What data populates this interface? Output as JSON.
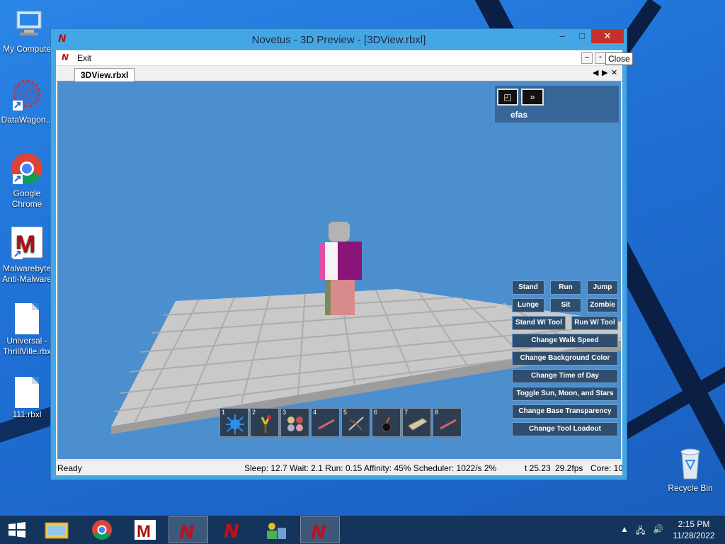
{
  "desktop": {
    "icons": [
      {
        "label": "My Compute",
        "icon": "computer-icon"
      },
      {
        "label": "DataWagon...",
        "icon": "datawagon-icon"
      },
      {
        "label": "Google Chrome",
        "icon": "chrome-icon"
      },
      {
        "label": "Malwarebyte Anti-Malware",
        "icon": "malwarebytes-icon"
      },
      {
        "label": "Universal - ThrillVille.rbx",
        "icon": "document-icon"
      },
      {
        "label": "111.rbxl",
        "icon": "document-icon"
      },
      {
        "label": "Recycle Bin",
        "icon": "recycle-bin-icon"
      }
    ]
  },
  "window": {
    "title": "Novetus - 3D Preview - [3DView.rbxl]",
    "logo": "N",
    "min_label": "–",
    "max_label": "□",
    "close_label": "✕",
    "menu": {
      "exit_label": "Exit"
    },
    "tooltip": "Close",
    "tab_label": "3DView.rbxl",
    "tab_nav": {
      "prev": "◀",
      "next": "▶",
      "close": "✕"
    }
  },
  "game": {
    "player_name": "efas",
    "player_panel_buttons": [
      "◰",
      "»"
    ],
    "actions": [
      "Stand",
      "Run",
      "Jump",
      "Lunge",
      "Sit",
      "Zombie",
      "Stand W/ Tool",
      "Run W/ Tool",
      "Change Walk Speed",
      "Change Background Color",
      "Change Time of Day",
      "Toggle Sun, Moon, and Stars",
      "Change Base Transparency",
      "Change Tool Loadout"
    ],
    "hotbar": [
      "1",
      "2",
      "3",
      "4",
      "5",
      "6",
      "7",
      "8"
    ],
    "colors": {
      "sky": "#4b8fcf",
      "baseplate": "#c9c9c9",
      "torso": "#8a1478",
      "arm_left": "#e84aa8",
      "legs": "#d98a8a"
    }
  },
  "status": {
    "ready": "Ready",
    "stats": "Sleep: 12.7 Wait: 2.1 Run: 0.15 Affinity: 45% Scheduler: 1022/s 2%",
    "time": "t 25.23",
    "fps": "29.2fps",
    "cores": "Core: 10."
  },
  "taskbar": {
    "clock_time": "2:15 PM",
    "clock_date": "11/28/2022",
    "items": [
      "start-icon",
      "file-explorer-icon",
      "chrome-icon",
      "malwarebytes-icon",
      "novetus-icon",
      "novetus-icon",
      "network-app-icon",
      "novetus-icon"
    ]
  }
}
